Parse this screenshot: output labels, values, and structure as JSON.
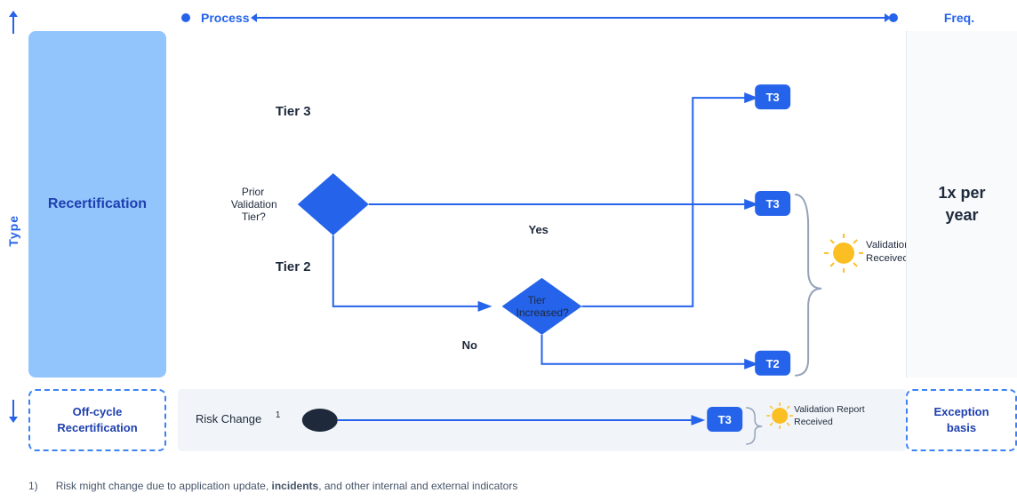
{
  "header": {
    "process_label": "Process",
    "freq_label": "Freq.",
    "type_label": "Type"
  },
  "sidebar": {
    "recert_label": "Recertification",
    "offcycle_label": "Off-cycle\nRecertification"
  },
  "diagram": {
    "tier3_label": "Tier 3",
    "tier2_label": "Tier 2",
    "prior_validation_label": "Prior\nValidation\nTier?",
    "tier_increased_label": "Tier\nIncreased?",
    "yes_label": "Yes",
    "no_label": "No",
    "t3_badge": "T3",
    "t2_badge": "T2",
    "validation_received_label": "Validation\nReceived",
    "validation_report_received_label": "Validation Report\nReceived",
    "risk_change_label": "Risk Change",
    "risk_change_superscript": "1"
  },
  "freq": {
    "value": "1x per\nyear"
  },
  "exception": {
    "label": "Exception\nbasis"
  },
  "footer": {
    "note_number": "1)",
    "note_text": "Risk might change due to application update, ",
    "note_bold": "incidents",
    "note_text2": ", and other internal and external indicators"
  }
}
